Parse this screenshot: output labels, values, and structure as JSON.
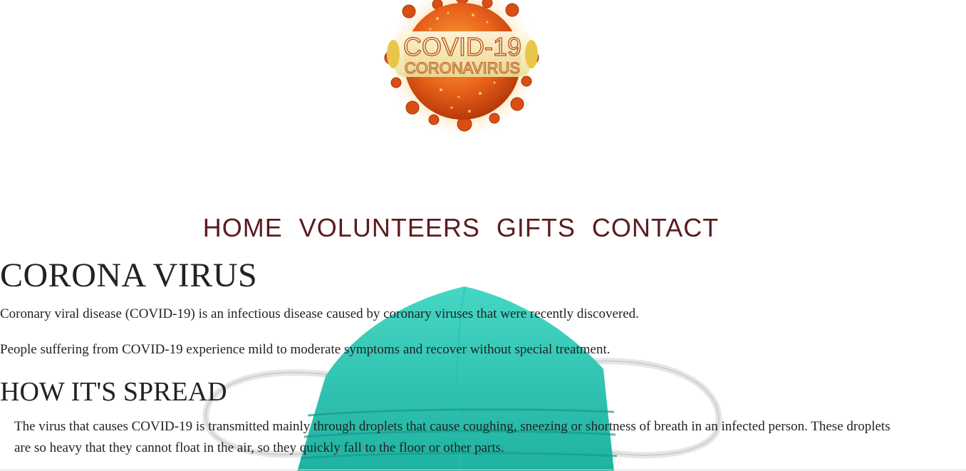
{
  "logo": {
    "title_line1": "COVID-19",
    "title_line2": "CORONAVIRUS",
    "colors": {
      "virus_body": "#e8611a",
      "virus_dark": "#b83a0a",
      "banner": "#f5efc8",
      "banner_text": "#b4541a"
    }
  },
  "nav": {
    "items": [
      {
        "label": "HOME"
      },
      {
        "label": "VOLUNTEERS"
      },
      {
        "label": "GIFTS"
      },
      {
        "label": "CONTACT"
      }
    ],
    "color": "#5a1c1f"
  },
  "main": {
    "heading": "CORONA VIRUS",
    "paragraph1": "Coronary viral disease (COVID-19) is an infectious disease caused by coronary viruses that were recently discovered.",
    "paragraph2": "People suffering from COVID-19 experience mild to moderate symptoms and recover without special treatment.",
    "subheading": "HOW IT'S SPREAD",
    "paragraph3": "The virus that causes COVID-19 is transmitted mainly through droplets that cause coughing, sneezing or shortness of breath in an infected person. These droplets are so heavy that they cannot float in the air, so they quickly fall to the floor or other parts."
  },
  "background_image": {
    "subject": "surgical-face-mask",
    "color": "#2ec4b0"
  }
}
